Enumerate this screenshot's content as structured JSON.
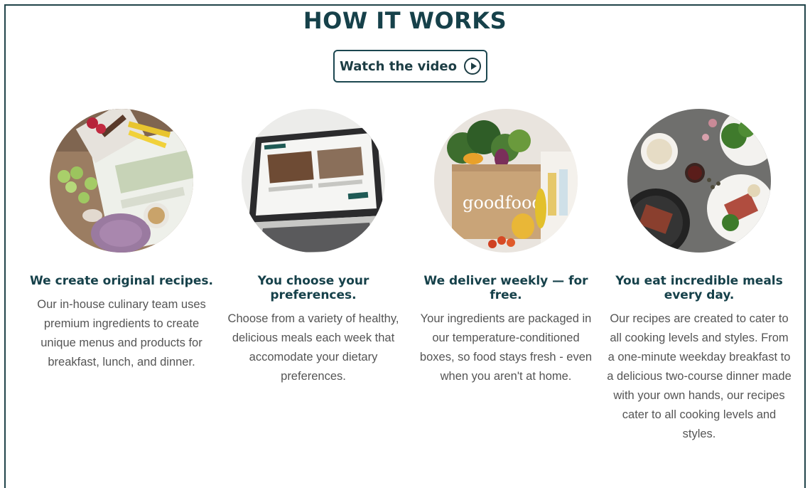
{
  "header": {
    "title": "HOW IT WORKS",
    "video_label": "Watch the video",
    "video_icon": "play-circle-icon"
  },
  "steps": [
    {
      "title": "We create original recipes.",
      "description": "Our in-house culinary team uses premium ingredients to create unique menus and products for breakfast, lunch, and dinner."
    },
    {
      "title": "You choose your preferences.",
      "description": "Choose from a variety of healthy, delicious meals each week that accomodate your dietary preferences."
    },
    {
      "title": "We deliver weekly — for free.",
      "description": "Your ingredients are packaged in our temperature-conditioned boxes, so food stays fresh - even when you aren't at home.",
      "box_brand": "goodfood"
    },
    {
      "title": "You eat incredible meals every day.",
      "description": "Our recipes are created to cater to all cooking levels and styles. From a one-minute weekday breakfast to a delicious two-course dinner made with your own hands, our recipes cater to all cooking levels and styles."
    }
  ],
  "colors": {
    "heading": "#16414a",
    "body_text": "#555555",
    "border": "#21444a"
  }
}
